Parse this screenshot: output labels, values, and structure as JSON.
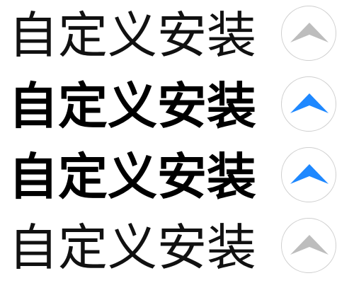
{
  "options": [
    {
      "label": "自定义安装",
      "state": "inactive",
      "arrow_color": "#bdbdbd",
      "icon": "chevron-up-icon"
    },
    {
      "label": "自定义安装",
      "state": "active",
      "arrow_color": "#1e88ff",
      "icon": "chevron-up-icon"
    },
    {
      "label": "自定义安装",
      "state": "active",
      "arrow_color": "#1e88ff",
      "icon": "chevron-up-icon"
    },
    {
      "label": "自定义安装",
      "state": "inactive",
      "arrow_color": "#bdbdbd",
      "icon": "chevron-up-icon"
    }
  ],
  "colors": {
    "active": "#1e88ff",
    "inactive": "#bdbdbd",
    "button_border": "#cfcfcf",
    "text": "#111111"
  }
}
